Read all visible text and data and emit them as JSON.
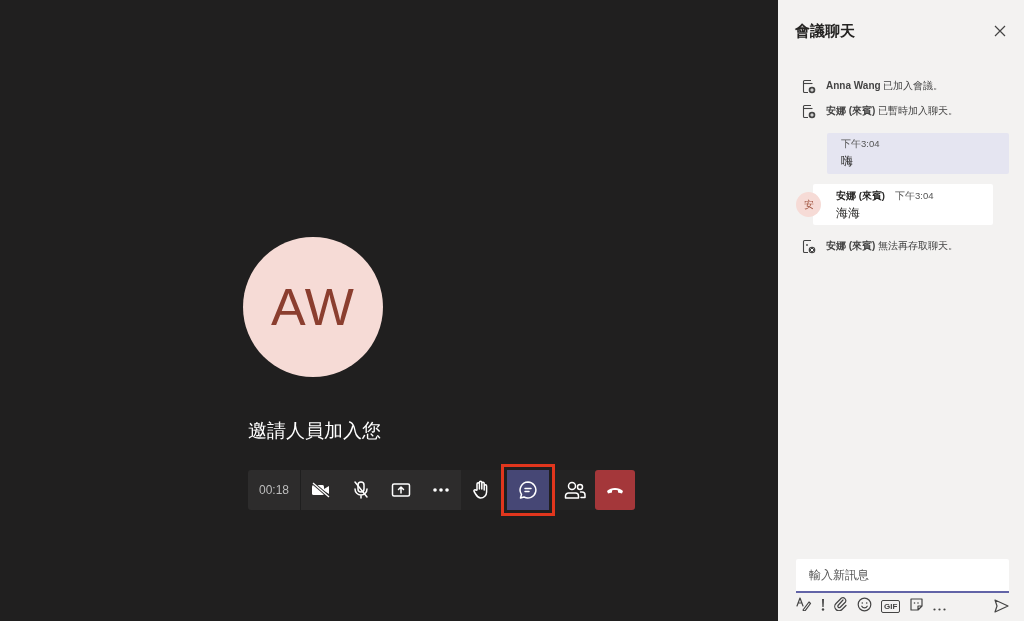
{
  "stage": {
    "avatar_initials": "AW",
    "caption": "邀請人員加入您"
  },
  "toolbar": {
    "timer": "00:18",
    "buttons": [
      {
        "kind": "camera-off",
        "selected": false,
        "highlighted": false
      },
      {
        "kind": "mic-off",
        "selected": false,
        "highlighted": false
      },
      {
        "kind": "share",
        "selected": false,
        "highlighted": false
      },
      {
        "kind": "more",
        "selected": false,
        "highlighted": false
      },
      {
        "kind": "hand",
        "selected": false,
        "highlighted": false
      },
      {
        "kind": "chat",
        "selected": true,
        "highlighted": true
      },
      {
        "kind": "people",
        "selected": false,
        "highlighted": false
      },
      {
        "kind": "hangup",
        "selected": false,
        "highlighted": false
      }
    ]
  },
  "chat": {
    "title": "會議聊天",
    "messages": [
      {
        "kind": "system",
        "sender": "Anna Wang",
        "text": "已加入會議。"
      },
      {
        "kind": "system",
        "sender": "安娜 (來賓)",
        "text": "已暫時加入聊天。"
      },
      {
        "kind": "self",
        "time": "下午3:04",
        "text": "嗨"
      },
      {
        "kind": "other",
        "avatar": "安",
        "sender": "安娜 (來賓)",
        "time": "下午3:04",
        "text": "海海"
      },
      {
        "kind": "system-left",
        "sender": "安娜 (來賓)",
        "text": "無法再存取聊天。"
      }
    ],
    "composer": {
      "placeholder": "輸入新訊息",
      "gif_label": "GIF"
    }
  }
}
